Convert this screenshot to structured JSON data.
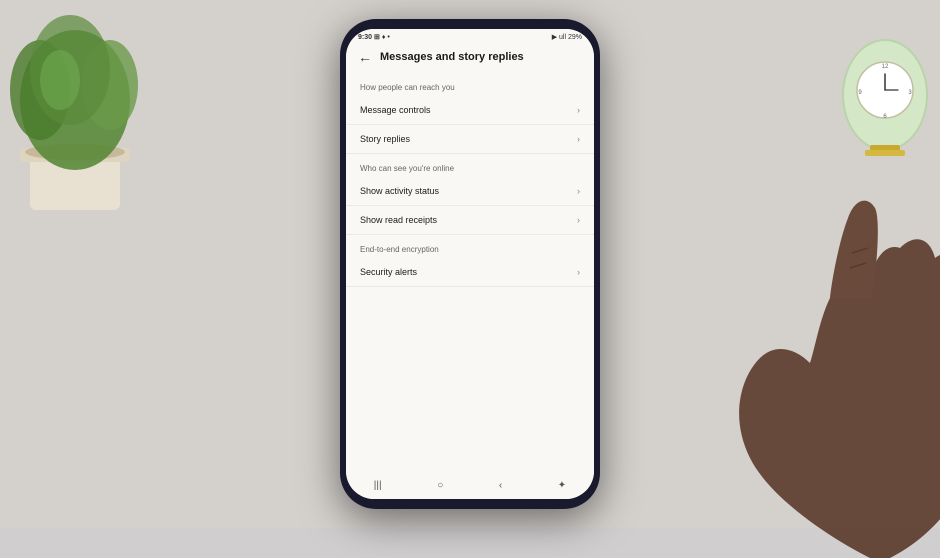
{
  "desk": {
    "bg_color": "#d4d0cc"
  },
  "status_bar": {
    "time": "9:30",
    "icons_left": "⊞ ♦ ⊕ •",
    "icons_right": "▶ ⬆ ull 29%"
  },
  "top_bar": {
    "title": "Messages and story replies",
    "back_label": "←"
  },
  "sections": [
    {
      "label": "How people can reach you",
      "items": [
        {
          "text": "Message controls",
          "has_chevron": true
        },
        {
          "text": "Story replies",
          "has_chevron": true
        }
      ]
    },
    {
      "label": "Who can see you're online",
      "items": [
        {
          "text": "Show activity status",
          "has_chevron": true
        },
        {
          "text": "Show read receipts",
          "has_chevron": true
        }
      ]
    },
    {
      "label": "End-to-end encryption",
      "items": [
        {
          "text": "Security alerts",
          "has_chevron": true
        }
      ]
    }
  ],
  "nav_bar": {
    "icons": [
      "|||",
      "○",
      "<",
      "✦"
    ]
  }
}
